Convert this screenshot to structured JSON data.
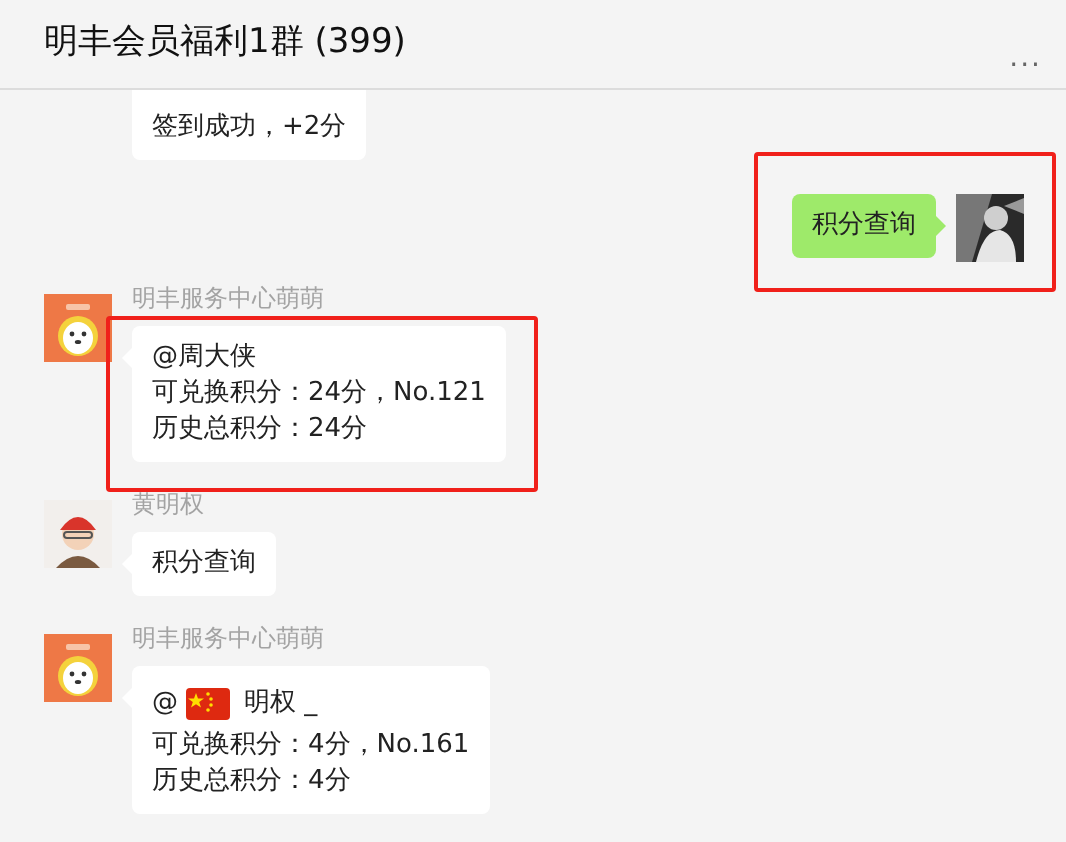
{
  "header": {
    "title": "明丰会员福利1群 (399)",
    "menu": "..."
  },
  "messages": [
    {
      "kind": "incoming",
      "highlighted": false,
      "lines": [
        {
          "kind": "text",
          "text": "签到成功，+2分"
        }
      ]
    },
    {
      "kind": "outgoing",
      "highlighted": true,
      "lines": [
        {
          "kind": "text",
          "text": "积分查询"
        }
      ]
    },
    {
      "kind": "incoming",
      "sender": "明丰服务中心萌萌",
      "avatar": {
        "kind": "dog"
      },
      "highlighted": true,
      "lines": [
        {
          "kind": "text",
          "text": "@周大侠"
        },
        {
          "kind": "text",
          "text": "可兑换积分：24分，No.121"
        },
        {
          "kind": "text",
          "text": "历史总积分：24分"
        }
      ]
    },
    {
      "kind": "incoming",
      "sender": "黄明权",
      "avatar": {
        "kind": "person"
      },
      "highlighted": false,
      "lines": [
        {
          "kind": "text",
          "text": "积分查询"
        }
      ]
    },
    {
      "kind": "incoming",
      "sender": "明丰服务中心萌萌",
      "avatar": {
        "kind": "dog"
      },
      "highlighted": false,
      "lines": [
        {
          "kind": "flag-mention",
          "before": "@",
          "after": "明权 _"
        },
        {
          "kind": "text",
          "text": "可兑换积分：4分，No.161"
        },
        {
          "kind": "text",
          "text": "历史总积分：4分"
        }
      ]
    }
  ]
}
